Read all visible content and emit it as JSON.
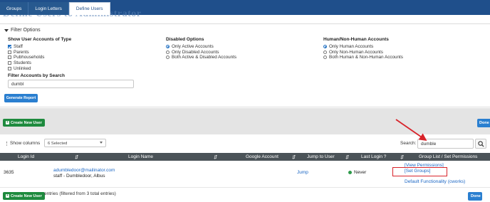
{
  "header": {
    "page_title": "Define Users to Administrator",
    "tabs": [
      {
        "label": "Groups",
        "active": false
      },
      {
        "label": "Login Letters",
        "active": false
      },
      {
        "label": "Define Users",
        "active": true
      }
    ]
  },
  "filter": {
    "section_title": "Filter Options",
    "account_types": {
      "heading": "Show User Accounts of Type",
      "options": [
        {
          "label": "Staff",
          "checked": true
        },
        {
          "label": "Parents",
          "checked": false
        },
        {
          "label": "Pubhouseholds",
          "checked": false
        },
        {
          "label": "Students",
          "checked": false
        },
        {
          "label": "Unlinked",
          "checked": false
        }
      ]
    },
    "disabled": {
      "heading": "Disabled Options",
      "options": [
        {
          "label": "Only Active Accounts",
          "checked": true
        },
        {
          "label": "Only Disabled Accounts",
          "checked": false
        },
        {
          "label": "Both Active & Disabled Accounts",
          "checked": false
        }
      ]
    },
    "human": {
      "heading": "Human/Non-Human Accounts",
      "options": [
        {
          "label": "Only Human Accounts",
          "checked": true
        },
        {
          "label": "Only Non-Human Accounts",
          "checked": false
        },
        {
          "label": "Both Human & Non-Human Accounts",
          "checked": false
        }
      ]
    },
    "search_label": "Filter Accounts by Search",
    "search_value": "dumbl",
    "generate_button": "Generate Report"
  },
  "actions": {
    "create_new_user": "Create New User",
    "done": "Done"
  },
  "table_controls": {
    "show_columns_label": "Show columns",
    "show_columns_value": "6 Selected",
    "search_label": "Search:",
    "search_value": "dumble"
  },
  "table": {
    "columns": [
      "Login Id",
      "Login Name",
      "Google Account",
      "Jump to User",
      "Last Login ?",
      "Group List / Set Permissions"
    ],
    "rows": [
      {
        "login_id": "3635",
        "email": "adumbledoor@mailinator.com",
        "name": "staff - Dumbledoor, Albus",
        "jump": "Jump",
        "last_login": "Never",
        "view_permissions": "[View Permissions]",
        "set_groups": "[Set Groups]",
        "default_functionality": "Default Functionality (cworks)"
      }
    ]
  },
  "footer": {
    "entries_text": "entries (filtered from 3 total entries)"
  },
  "colors": {
    "header": "#1f4f8b",
    "primary_button": "#2a7fd0",
    "create_button": "#1e8a3e",
    "table_header": "#4b5358",
    "annotation": "#d8232a"
  }
}
